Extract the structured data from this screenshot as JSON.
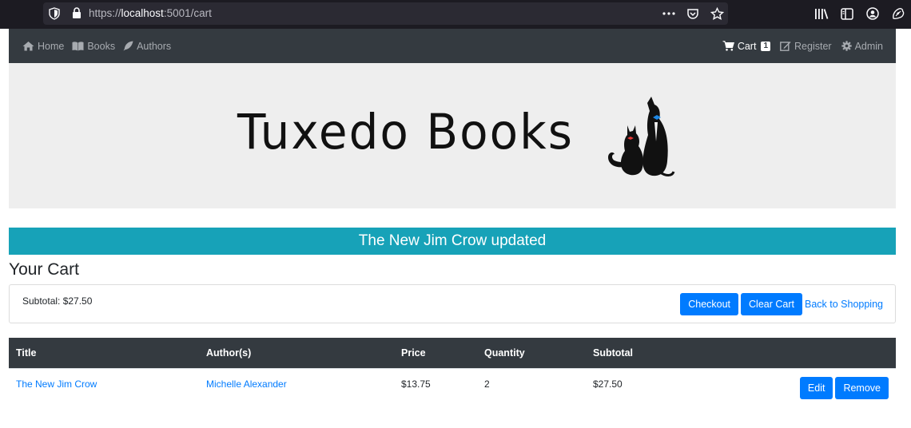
{
  "browser": {
    "url_scheme": "https://",
    "url_host": "localhost",
    "url_rest": ":5001/cart",
    "url_actions": [
      "more-icon",
      "pocket-icon",
      "bookmark-star-icon"
    ],
    "tools": [
      "library-icon",
      "sidebar-icon",
      "account-icon",
      "extension-icon"
    ]
  },
  "nav": {
    "left": [
      {
        "label": "Home",
        "icon": "home-icon"
      },
      {
        "label": "Books",
        "icon": "book-icon"
      },
      {
        "label": "Authors",
        "icon": "feather-icon"
      }
    ],
    "right": {
      "cart_label": "Cart",
      "cart_count": "1",
      "register_label": "Register",
      "admin_label": "Admin"
    }
  },
  "banner": {
    "logo_text": "Tuxedo Books"
  },
  "alert": {
    "message": "The New Jim Crow updated",
    "color": "#17a2b8"
  },
  "cart": {
    "heading": "Your Cart",
    "subtotal_text": "Subtotal: $27.50",
    "checkout_label": "Checkout",
    "clear_label": "Clear Cart",
    "back_label": "Back to Shopping"
  },
  "table": {
    "headers": [
      "Title",
      "Author(s)",
      "Price",
      "Quantity",
      "Subtotal"
    ],
    "rows": [
      {
        "title": "The New Jim Crow",
        "author": "Michelle Alexander",
        "price": "$13.75",
        "quantity": "2",
        "subtotal": "$27.50",
        "edit_label": "Edit",
        "remove_label": "Remove"
      }
    ]
  },
  "colors": {
    "primary": "#007bff",
    "navbar": "#343a40",
    "info": "#17a2b8"
  }
}
